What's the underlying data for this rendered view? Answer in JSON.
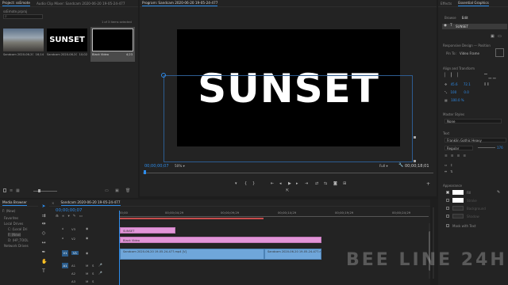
{
  "project": {
    "tabs": [
      "Project: ssEmote",
      "Audio Clip Mixer: Sandcam 2020-06-20 19-05-24-477"
    ],
    "search_placeholder": "",
    "path": "ssEmote.prproj",
    "selection_info": "1 of 3 items selected",
    "items": [
      {
        "name": "Sandcam 2020-06-20 19...",
        "duration": "16;14"
      },
      {
        "name": "Sandcam 2020-06-20 19...",
        "duration": "10;02",
        "thumb_text": "SUNSET"
      },
      {
        "name": "Black Video",
        "duration": "4;23"
      }
    ]
  },
  "monitor": {
    "title": "Program: Sandcam 2020-06-20 19-05-24-477",
    "title_text": "SUNSET",
    "timecode_left": "00;00;00;07",
    "zoom": "50%",
    "resolution": "Full",
    "timecode_right": "00;00;18;01"
  },
  "essential_graphics": {
    "tabs": [
      "Effects",
      "Essential Graphics"
    ],
    "subtabs": [
      "Browse",
      "Edit"
    ],
    "layer_name": "SUNSET",
    "responsive_label": "Responsive Design — Position",
    "pin_to_label": "Pin To:",
    "pin_to_value": "Video Frame",
    "align_label": "Align and Transform",
    "position_x": "45.6",
    "position_y": "72.1",
    "scale_value": "100",
    "rotation": "0.0",
    "opacity": "100.0 %",
    "master_styles_label": "Master Styles",
    "master_styles_value": "None",
    "text_label": "Text",
    "font": "Franklin Gothic Heavy",
    "font_style": "Regular",
    "font_size": "176",
    "appearance_label": "Appearance",
    "fill_label": "Fill",
    "stroke_label": "Stroke",
    "background_label": "Background",
    "shadow_label": "Shadow",
    "mask_label": "Mask with Text",
    "colors": {
      "fill": "#ffffff",
      "stroke": "#ffffff",
      "background": "#303030",
      "shadow": "#303030"
    }
  },
  "media_browser": {
    "tabs": [
      "Media Browser",
      "Libraries"
    ],
    "drive": "F: (New)",
    "favorites": "Favorites",
    "local_drives": "Local Drives",
    "drives": [
      "C: (Local Dri",
      "F: (New)",
      "D: (HP_TOOL"
    ],
    "network": "Network Drives"
  },
  "timeline": {
    "title": "Sandcam 2020-06-20 19-05-24-477",
    "timecode": "00;00;00;07",
    "ruler": [
      "00;00",
      "00;00;04;29",
      "00;00;09;29",
      "00;00;14;29",
      "00;00;19;29",
      "00;00;24;29"
    ],
    "tracks_video": [
      "V3",
      "V2",
      "V1"
    ],
    "tracks_audio": [
      "A1",
      "A2",
      "A3"
    ],
    "clips": [
      {
        "name": "SUNSET",
        "track": "V3"
      },
      {
        "name": "Black Video",
        "track": "V2"
      },
      {
        "name": "Sandcam 2020-06-20 19-05-24-477.mp4 [V]",
        "track": "V1"
      },
      {
        "name": "Sandcam 2020-06-20 19-05-24-477.mp4 [V]",
        "track": "V1b"
      }
    ]
  },
  "watermark": "BEE LINE 24H"
}
